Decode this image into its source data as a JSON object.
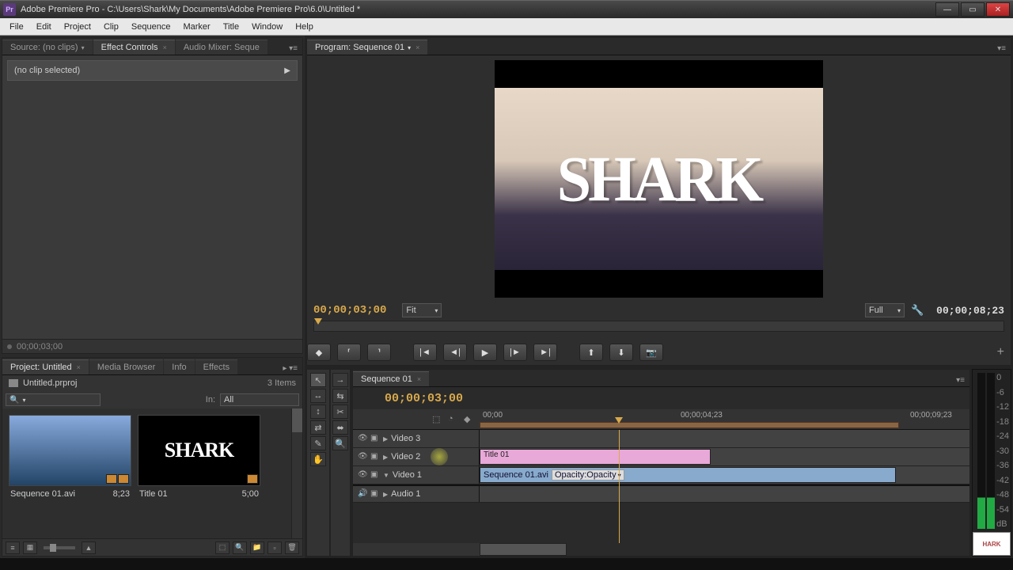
{
  "titlebar": {
    "app_icon": "Pr",
    "title": "Adobe Premiere Pro - C:\\Users\\Shark\\My Documents\\Adobe Premiere Pro\\6.0\\Untitled *"
  },
  "menu": [
    "File",
    "Edit",
    "Project",
    "Clip",
    "Sequence",
    "Marker",
    "Title",
    "Window",
    "Help"
  ],
  "source_panel": {
    "tabs": [
      {
        "label": "Source: (no clips)",
        "active": false
      },
      {
        "label": "Effect Controls",
        "active": true
      },
      {
        "label": "Audio Mixer: Seque",
        "active": false
      }
    ],
    "no_clip_text": "(no clip selected)",
    "footer_tc": "00;00;03;00"
  },
  "program": {
    "tab": "Program: Sequence 01",
    "preview_text": "SHARK",
    "timecode": "00;00;03;00",
    "fit": "Fit",
    "full": "Full",
    "duration": "00;00;08;23"
  },
  "project": {
    "tabs": [
      "Project: Untitled",
      "Media Browser",
      "Info",
      "Effects"
    ],
    "file": "Untitled.prproj",
    "item_count": "3 Items",
    "filter_in": "In:",
    "filter_all": "All",
    "clips": [
      {
        "name": "Sequence 01.avi",
        "dur": "8;23",
        "kind": "seq"
      },
      {
        "name": "Title 01",
        "dur": "5;00",
        "kind": "title"
      }
    ]
  },
  "timeline": {
    "tab": "Sequence 01",
    "timecode": "00;00;03;00",
    "ruler": [
      "00;00",
      "00;00;04;23",
      "00;00;09;23"
    ],
    "tracks": {
      "v3": "Video 3",
      "v2": "Video 2",
      "v1": "Video 1",
      "a1": "Audio 1"
    },
    "clip_title": "Title 01",
    "clip_video": "Sequence 01.avi",
    "clip_opacity": "Opacity:Opacity"
  },
  "meters": {
    "ticks": [
      "0",
      "-6",
      "-12",
      "-18",
      "-24",
      "-30",
      "-36",
      "-42",
      "-48",
      "-54",
      "dB"
    ],
    "foot_label": "HARK"
  }
}
